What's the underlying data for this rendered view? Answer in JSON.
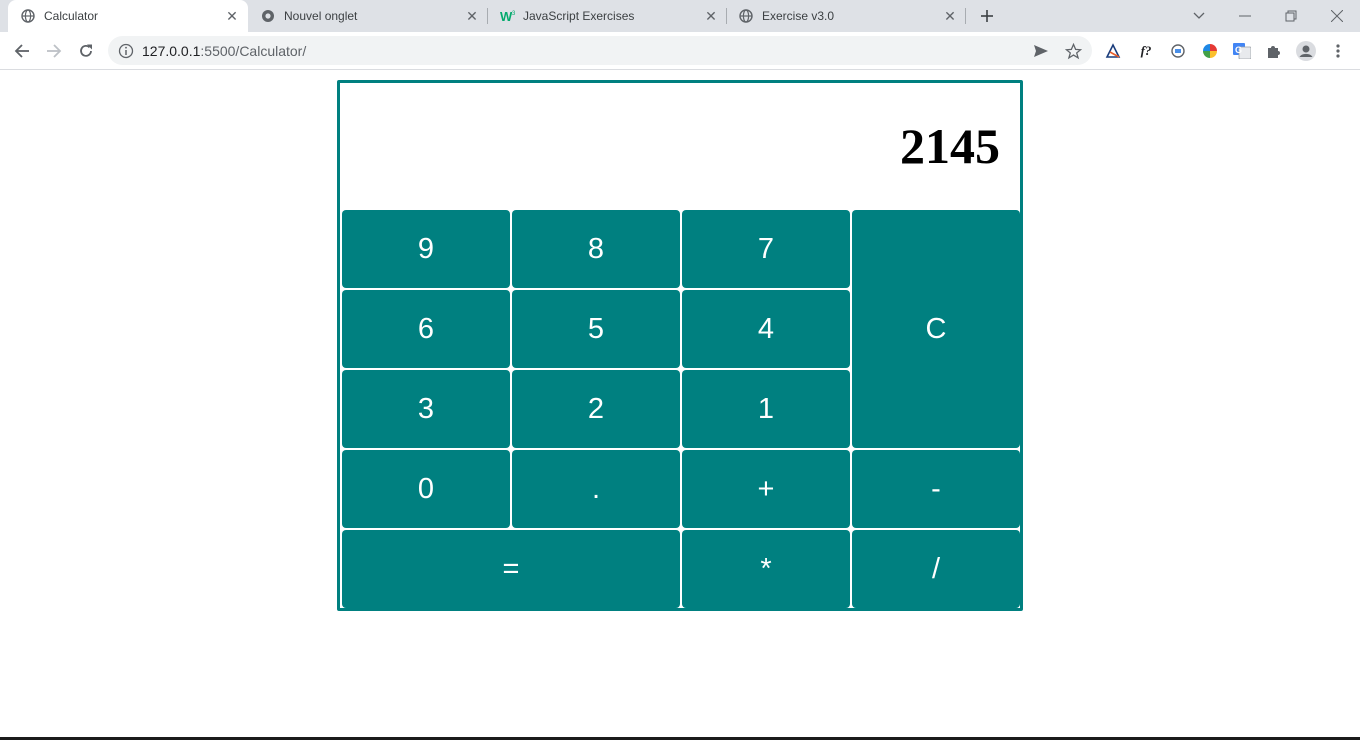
{
  "browser": {
    "tabs": [
      {
        "title": "Calculator",
        "icon": "globe-icon",
        "active": true
      },
      {
        "title": "Nouvel onglet",
        "icon": "chrome-icon",
        "active": false
      },
      {
        "title": "JavaScript Exercises",
        "icon": "w3schools-icon",
        "active": false
      },
      {
        "title": "Exercise v3.0",
        "icon": "globe-icon",
        "active": false
      }
    ],
    "url_host": "127.0.0.1",
    "url_rest": ":5500/Calculator/",
    "extensions": [
      "mathpix-icon",
      "formula-icon",
      "magnifier-icon",
      "color-wheel-icon",
      "translate-icon",
      "puzzle-icon",
      "profile-icon"
    ]
  },
  "calculator": {
    "display": "2145",
    "keys": {
      "k9": "9",
      "k8": "8",
      "k7": "7",
      "clear": "C",
      "k6": "6",
      "k5": "5",
      "k4": "4",
      "k3": "3",
      "k2": "2",
      "k1": "1",
      "k0": "0",
      "dot": ".",
      "plus": "+",
      "minus": "-",
      "equals": "=",
      "multiply": "*",
      "divide": "/"
    },
    "accent_color": "#008080"
  }
}
